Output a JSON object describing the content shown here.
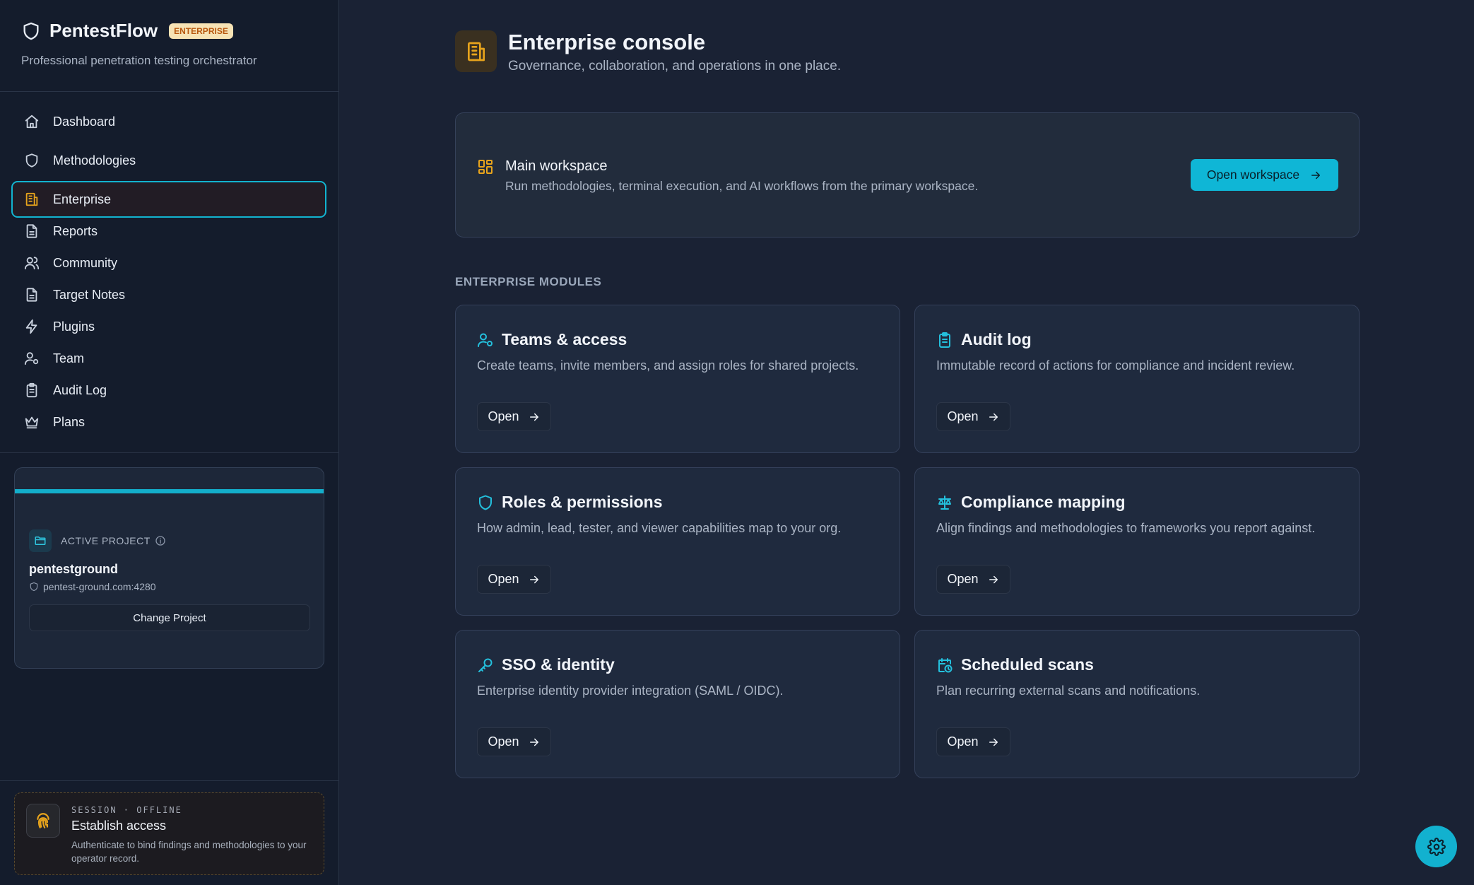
{
  "brand": {
    "name": "PentestFlow",
    "badge": "ENTERPRISE",
    "tagline": "Professional penetration testing orchestrator",
    "icon": "shield-icon"
  },
  "colors": {
    "accent": "#0fb6d6",
    "brand_amber": "#e8a41c",
    "background": "#1a2234",
    "sidebar": "#141c2c"
  },
  "sidebar": {
    "items": [
      {
        "label": "Dashboard",
        "icon": "home-icon"
      },
      {
        "label": "Methodologies",
        "icon": "shield-icon"
      },
      {
        "label": "Enterprise",
        "icon": "building-icon",
        "active": true
      },
      {
        "label": "Reports",
        "icon": "file-text-icon"
      },
      {
        "label": "Community",
        "icon": "users-icon"
      },
      {
        "label": "Target Notes",
        "icon": "file-text-icon"
      },
      {
        "label": "Plugins",
        "icon": "zap-icon"
      },
      {
        "label": "Team",
        "icon": "user-cog-icon"
      },
      {
        "label": "Audit Log",
        "icon": "clipboard-list-icon"
      },
      {
        "label": "Plans",
        "icon": "crown-icon"
      }
    ],
    "project": {
      "label": "ACTIVE PROJECT",
      "name": "pentestground",
      "host": "pentest-ground.com:4280",
      "change_label": "Change Project"
    },
    "session": {
      "kicker": "SESSION · OFFLINE",
      "title": "Establish access",
      "description": "Authenticate to bind findings and methodologies to your operator record.",
      "icon": "fingerprint-icon"
    }
  },
  "header": {
    "title": "Enterprise console",
    "subtitle": "Governance, collaboration, and operations in one place.",
    "icon": "building-icon"
  },
  "workspace": {
    "title": "Main workspace",
    "description": "Run methodologies, terminal execution, and AI workflows from the primary workspace.",
    "button_label": "Open workspace",
    "icon": "layout-grid-icon"
  },
  "modules": {
    "section_title": "ENTERPRISE MODULES",
    "items": [
      {
        "title": "Teams & access",
        "description": "Create teams, invite members, and assign roles for shared projects.",
        "button_label": "Open",
        "icon": "user-cog-icon"
      },
      {
        "title": "Audit log",
        "description": "Immutable record of actions for compliance and incident review.",
        "button_label": "Open",
        "icon": "clipboard-list-icon"
      },
      {
        "title": "Roles & permissions",
        "description": "How admin, lead, tester, and viewer capabilities map to your org.",
        "button_label": "Open",
        "icon": "shield-icon"
      },
      {
        "title": "Compliance mapping",
        "description": "Align findings and methodologies to frameworks you report against.",
        "button_label": "Open",
        "icon": "scale-icon"
      },
      {
        "title": "SSO & identity",
        "description": "Enterprise identity provider integration (SAML / OIDC).",
        "button_label": "Open",
        "icon": "key-icon"
      },
      {
        "title": "Scheduled scans",
        "description": "Plan recurring external scans and notifications.",
        "button_label": "Open",
        "icon": "calendar-clock-icon"
      }
    ]
  },
  "settings_fab": {
    "icon": "gear-icon"
  }
}
